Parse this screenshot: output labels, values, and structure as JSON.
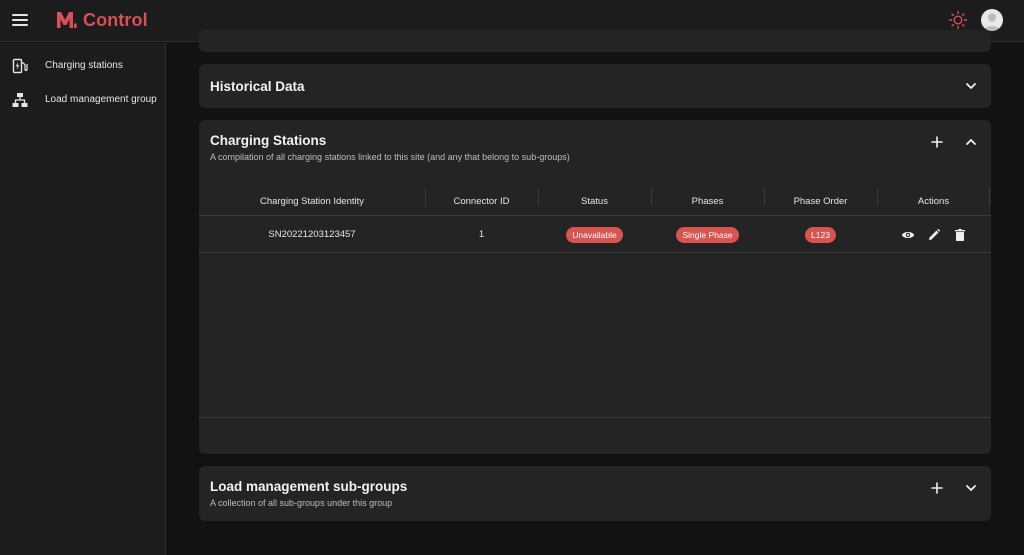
{
  "header": {
    "brand_name": "Control",
    "brand_color": "#d94f55",
    "menu_icon": "hamburger-menu-icon",
    "theme_icon": "sun-icon",
    "avatar_icon": "user-avatar"
  },
  "sidebar": {
    "items": [
      {
        "label": "Charging stations",
        "icon": "ev-charger-icon"
      },
      {
        "label": "Load management group",
        "icon": "hierarchy-icon"
      }
    ]
  },
  "historical": {
    "title": "Historical Data",
    "toggle_icon": "chevron-down-icon"
  },
  "stations": {
    "title": "Charging Stations",
    "subtitle": "A compilation of all charging stations linked to this site (and any that belong to sub-groups)",
    "add_icon": "plus-icon",
    "toggle_icon": "chevron-up-icon",
    "columns": [
      "Charging Station Identity",
      "Connector ID",
      "Status",
      "Phases",
      "Phase Order",
      "Actions"
    ],
    "rows": [
      {
        "identity": "SN20221203123457",
        "connector_id": "1",
        "status": "Unavailable",
        "phases": "Single Phase",
        "phase_order": "L123",
        "actions": [
          "view-icon",
          "edit-icon",
          "delete-icon"
        ]
      }
    ],
    "badge_color": "#d9534f"
  },
  "subgroups": {
    "title": "Load management sub-groups",
    "subtitle": "A collection of all sub-groups under this group",
    "add_icon": "plus-icon",
    "toggle_icon": "chevron-down-icon"
  }
}
